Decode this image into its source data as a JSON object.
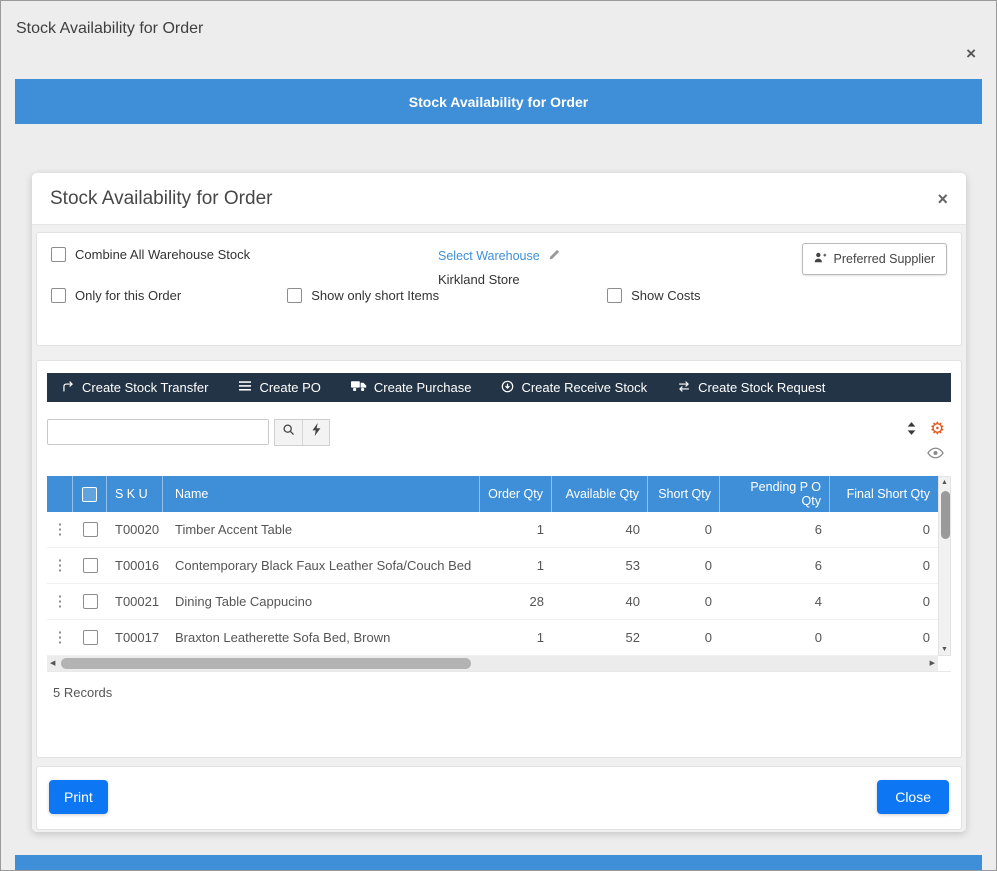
{
  "page": {
    "title": "Stock Availability for Order"
  },
  "banner": {
    "title": "Stock Availability for Order"
  },
  "modal": {
    "title": "Stock Availability for Order",
    "filters": {
      "combine_all_label": "Combine All Warehouse Stock",
      "select_warehouse_link": "Select Warehouse",
      "warehouse_name": "Kirkland Store",
      "preferred_supplier_label": "Preferred Supplier",
      "only_for_this_order_label": "Only for this Order",
      "show_only_short_label": "Show only short Items",
      "show_costs_label": "Show Costs"
    },
    "actions": [
      {
        "label": "Create Stock Transfer"
      },
      {
        "label": "Create PO"
      },
      {
        "label": "Create Purchase"
      },
      {
        "label": "Create Receive Stock"
      },
      {
        "label": "Create Stock Request"
      }
    ],
    "search": {
      "value": "",
      "placeholder": ""
    },
    "table": {
      "headers": {
        "sku": "S K U",
        "name": "Name",
        "order_qty": "Order Qty",
        "available_qty": "Available Qty",
        "short_qty": "Short Qty",
        "pending_po_qty": "Pending P O Qty",
        "final_short_qty": "Final Short Qty"
      },
      "rows": [
        {
          "sku": "T00020",
          "name": "Timber Accent Table",
          "order_qty": "1",
          "available_qty": "40",
          "short_qty": "0",
          "pending_po_qty": "6",
          "final_short_qty": "0"
        },
        {
          "sku": "T00016",
          "name": "Contemporary Black Faux Leather Sofa/Couch Bed",
          "order_qty": "1",
          "available_qty": "53",
          "short_qty": "0",
          "pending_po_qty": "6",
          "final_short_qty": "0"
        },
        {
          "sku": "T00021",
          "name": "Dining Table Cappucino",
          "order_qty": "28",
          "available_qty": "40",
          "short_qty": "0",
          "pending_po_qty": "4",
          "final_short_qty": "0"
        },
        {
          "sku": "T00017",
          "name": "Braxton Leatherette Sofa Bed, Brown",
          "order_qty": "1",
          "available_qty": "52",
          "short_qty": "0",
          "pending_po_qty": "0",
          "final_short_qty": "0"
        }
      ],
      "records_text": "5 Records"
    },
    "footer": {
      "print_label": "Print",
      "close_label": "Close"
    }
  },
  "icons": {
    "close": "×",
    "menu_dots": "⋮",
    "gear": "⚙",
    "scroll_up": "▲",
    "scroll_down": "▼",
    "scroll_left": "◀",
    "scroll_right": "▶"
  },
  "colors": {
    "banner_blue": "#3f8fd8",
    "toolbar_dark": "#233446",
    "table_header_blue": "#3f8fd8",
    "button_blue": "#0d76f2",
    "gear_orange": "#e2571c"
  }
}
